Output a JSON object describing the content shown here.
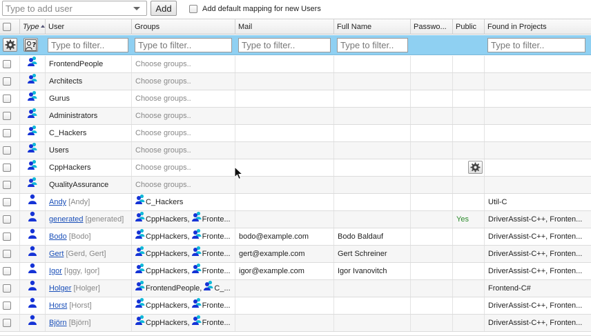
{
  "toolbar": {
    "user_input_placeholder": "Type to add user",
    "add_label": "Add",
    "default_mapping_label": "Add default mapping for new Users"
  },
  "columns": {
    "type": "Type",
    "user": "User",
    "groups": "Groups",
    "mail": "Mail",
    "full_name": "Full Name",
    "password": "Passwo...",
    "public": "Public",
    "projects": "Found in Projects"
  },
  "filters": {
    "placeholder": "Type to filter.."
  },
  "group_rows": [
    {
      "name": "FrontendPeople",
      "groups": "Choose groups.."
    },
    {
      "name": "Architects",
      "groups": "Choose groups.."
    },
    {
      "name": "Gurus",
      "groups": "Choose groups.."
    },
    {
      "name": "Administrators",
      "groups": "Choose groups.."
    },
    {
      "name": "C_Hackers",
      "groups": "Choose groups.."
    },
    {
      "name": "Users",
      "groups": "Choose groups.."
    },
    {
      "name": "CppHackers",
      "groups": "Choose groups.."
    },
    {
      "name": "QualityAssurance",
      "groups": "Choose groups.."
    }
  ],
  "user_rows": [
    {
      "name": "Andy",
      "alias": "[Andy]",
      "groups": [
        {
          "label": "C_Hackers",
          "sep": ""
        }
      ],
      "mail": "",
      "full_name": "",
      "public": "",
      "projects": "Util-C"
    },
    {
      "name": "generated",
      "alias": "[generated]",
      "groups": [
        {
          "label": "CppHackers",
          "sep": ","
        },
        {
          "label": "Fronte...",
          "sep": ""
        }
      ],
      "mail": "",
      "full_name": "",
      "public": "Yes",
      "projects": "DriverAssist-C++, Fronten..."
    },
    {
      "name": "Bodo",
      "alias": "[Bodo]",
      "groups": [
        {
          "label": "CppHackers",
          "sep": ","
        },
        {
          "label": "Fronte...",
          "sep": ""
        }
      ],
      "mail": "bodo@example.com",
      "full_name": "Bodo Baldauf",
      "public": "",
      "projects": "DriverAssist-C++, Fronten..."
    },
    {
      "name": "Gert",
      "alias": "[Gerd, Gert]",
      "groups": [
        {
          "label": "CppHackers",
          "sep": ","
        },
        {
          "label": "Fronte...",
          "sep": ""
        }
      ],
      "mail": "gert@example.com",
      "full_name": "Gert Schreiner",
      "public": "",
      "projects": "DriverAssist-C++, Fronten..."
    },
    {
      "name": "Igor",
      "alias": "[Iggy, Igor]",
      "groups": [
        {
          "label": "CppHackers",
          "sep": ","
        },
        {
          "label": "Fronte...",
          "sep": ""
        }
      ],
      "mail": "igor@example.com",
      "full_name": "Igor Ivanovitch",
      "public": "",
      "projects": "DriverAssist-C++, Fronten..."
    },
    {
      "name": "Holger",
      "alias": "[Holger]",
      "groups": [
        {
          "label": "FrontendPeople",
          "sep": ","
        },
        {
          "label": "C_...",
          "sep": ""
        }
      ],
      "mail": "",
      "full_name": "",
      "public": "",
      "projects": "Frontend-C#"
    },
    {
      "name": "Horst",
      "alias": "[Horst]",
      "groups": [
        {
          "label": "CppHackers",
          "sep": ","
        },
        {
          "label": "Fronte...",
          "sep": ""
        }
      ],
      "mail": "",
      "full_name": "",
      "public": "",
      "projects": "DriverAssist-C++, Fronten..."
    },
    {
      "name": "Björn",
      "alias": "[Björn]",
      "groups": [
        {
          "label": "CppHackers",
          "sep": ","
        },
        {
          "label": "Fronte...",
          "sep": ""
        }
      ],
      "mail": "",
      "full_name": "",
      "public": "",
      "projects": "DriverAssist-C++, Fronten..."
    }
  ],
  "colors": {
    "filter_row_bg": "#8fd0f2",
    "icon_blue": "#1533d6",
    "icon_cyan": "#12b8d8",
    "link": "#1a4fb8",
    "yes_green": "#2a8a2a"
  }
}
